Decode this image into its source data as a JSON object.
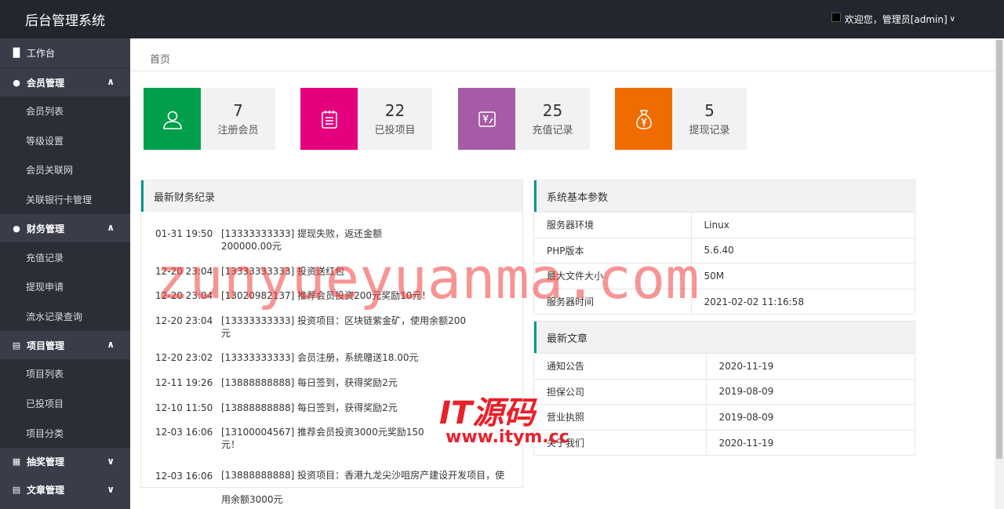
{
  "app": {
    "title": "后台管理系统"
  },
  "user": {
    "greeting": "欢迎您，管理员[admin]"
  },
  "sidebar": {
    "top": {
      "label": "工作台"
    },
    "groups": [
      {
        "label": "会员管理",
        "items": [
          "会员列表",
          "等级设置",
          "会员关联网",
          "关联银行卡管理"
        ]
      },
      {
        "label": "财务管理",
        "items": [
          "充值记录",
          "提现申请",
          "流水记录查询"
        ]
      },
      {
        "label": "项目管理",
        "items": [
          "项目列表",
          "已投项目",
          "项目分类"
        ]
      },
      {
        "label": "抽奖管理",
        "items": []
      },
      {
        "label": "文章管理",
        "items": []
      }
    ]
  },
  "breadcrumb": {
    "label": "首页"
  },
  "stats": [
    {
      "value": "7",
      "label": "注册会员",
      "color": "#009f4c"
    },
    {
      "value": "22",
      "label": "已投项目",
      "color": "#e5007e"
    },
    {
      "value": "25",
      "label": "充值记录",
      "color": "#a55ba6"
    },
    {
      "value": "5",
      "label": "提现记录",
      "color": "#f06b00"
    }
  ],
  "finance": {
    "title": "最新财务纪录",
    "rows": [
      {
        "time": "01-31 19:50",
        "msg": "[13333333333] 提现失败，返还金额200000.00元"
      },
      {
        "time": "12-20 23:04",
        "msg": "[13333333333] 投资送红包"
      },
      {
        "time": "12-20 23:04",
        "msg": "[13020982137] 推荐会员投资200元奖励10元！"
      },
      {
        "time": "12-20 23:04",
        "msg": "[13333333333] 投资项目：区块链紫金矿，使用余额200元"
      },
      {
        "time": "12-20 23:02",
        "msg": "[13333333333] 会员注册，系统赠送18.00元"
      },
      {
        "time": "12-11 19:26",
        "msg": "[13888888888] 每日签到，获得奖励2元"
      },
      {
        "time": "12-10 11:50",
        "msg": "[13888888888] 每日签到，获得奖励2元"
      },
      {
        "time": "12-03 16:06",
        "msg": "[13100004567] 推荐会员投资3000元奖励150元！"
      },
      {
        "time": "12-03 16:06",
        "msg": "[13888888888] 投资项目：香港九龙尖沙咀房产建设开发项目，使用余额3000元"
      }
    ]
  },
  "system": {
    "title": "系统基本参数",
    "rows": [
      {
        "key": "服务器环境",
        "value": "Linux"
      },
      {
        "key": "PHP版本",
        "value": "5.6.40"
      },
      {
        "key": "最大文件大小",
        "value": "50M"
      },
      {
        "key": "服务器时间",
        "value": "2021-02-02 11:16:58"
      }
    ]
  },
  "articles": {
    "title": "最新文章",
    "rows": [
      {
        "key": "通知公告",
        "value": "2020-11-19"
      },
      {
        "key": "担保公司",
        "value": "2019-08-09"
      },
      {
        "key": "营业执照",
        "value": "2019-08-09"
      },
      {
        "key": "关于我们",
        "value": "2020-11-19"
      }
    ]
  },
  "watermarks": {
    "main": "zunyueyuanma.com",
    "logo": "IT源码",
    "url": "www.itym.cc"
  }
}
